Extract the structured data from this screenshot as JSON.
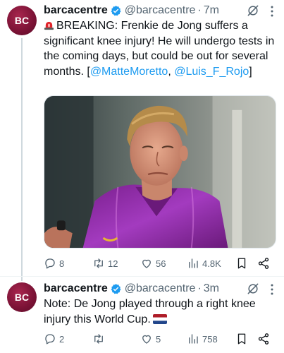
{
  "tweets": [
    {
      "name": "barcacentre",
      "handle": "@barcacentre",
      "dot": "·",
      "time": "7m",
      "text_main": "BREAKING: Frenkie de Jong suffers a significant knee injury! He will undergo tests in the coming days, but could be out for several months. [",
      "mention_1": "@MatteMoretto",
      "separator": ", ",
      "mention_2": "@Luis_F_Rojo",
      "text_end": "]",
      "stats": {
        "replies": "8",
        "retweets": "12",
        "likes": "56",
        "views": "4.8K"
      }
    },
    {
      "name": "barcacentre",
      "handle": "@barcacentre",
      "dot": "·",
      "time": "3m",
      "text_main": "Note: De Jong played through a right knee injury this World Cup.",
      "stats": {
        "replies": "2",
        "retweets": "",
        "likes": "5",
        "views": "758"
      }
    }
  ],
  "avatar_initials": "BC",
  "colors": {
    "verified": "#1d9bf0",
    "link": "#1d9bf0",
    "secondary_text": "#536471",
    "avatar_bg": "#7a1235",
    "jersey": "#9b2fb0"
  },
  "icons": [
    "verified-badge-icon",
    "grok-icon",
    "more-icon",
    "siren-emoji",
    "reply-icon",
    "retweet-icon",
    "like-icon",
    "views-icon",
    "bookmark-icon",
    "share-icon",
    "netherlands-flag-emoji"
  ]
}
